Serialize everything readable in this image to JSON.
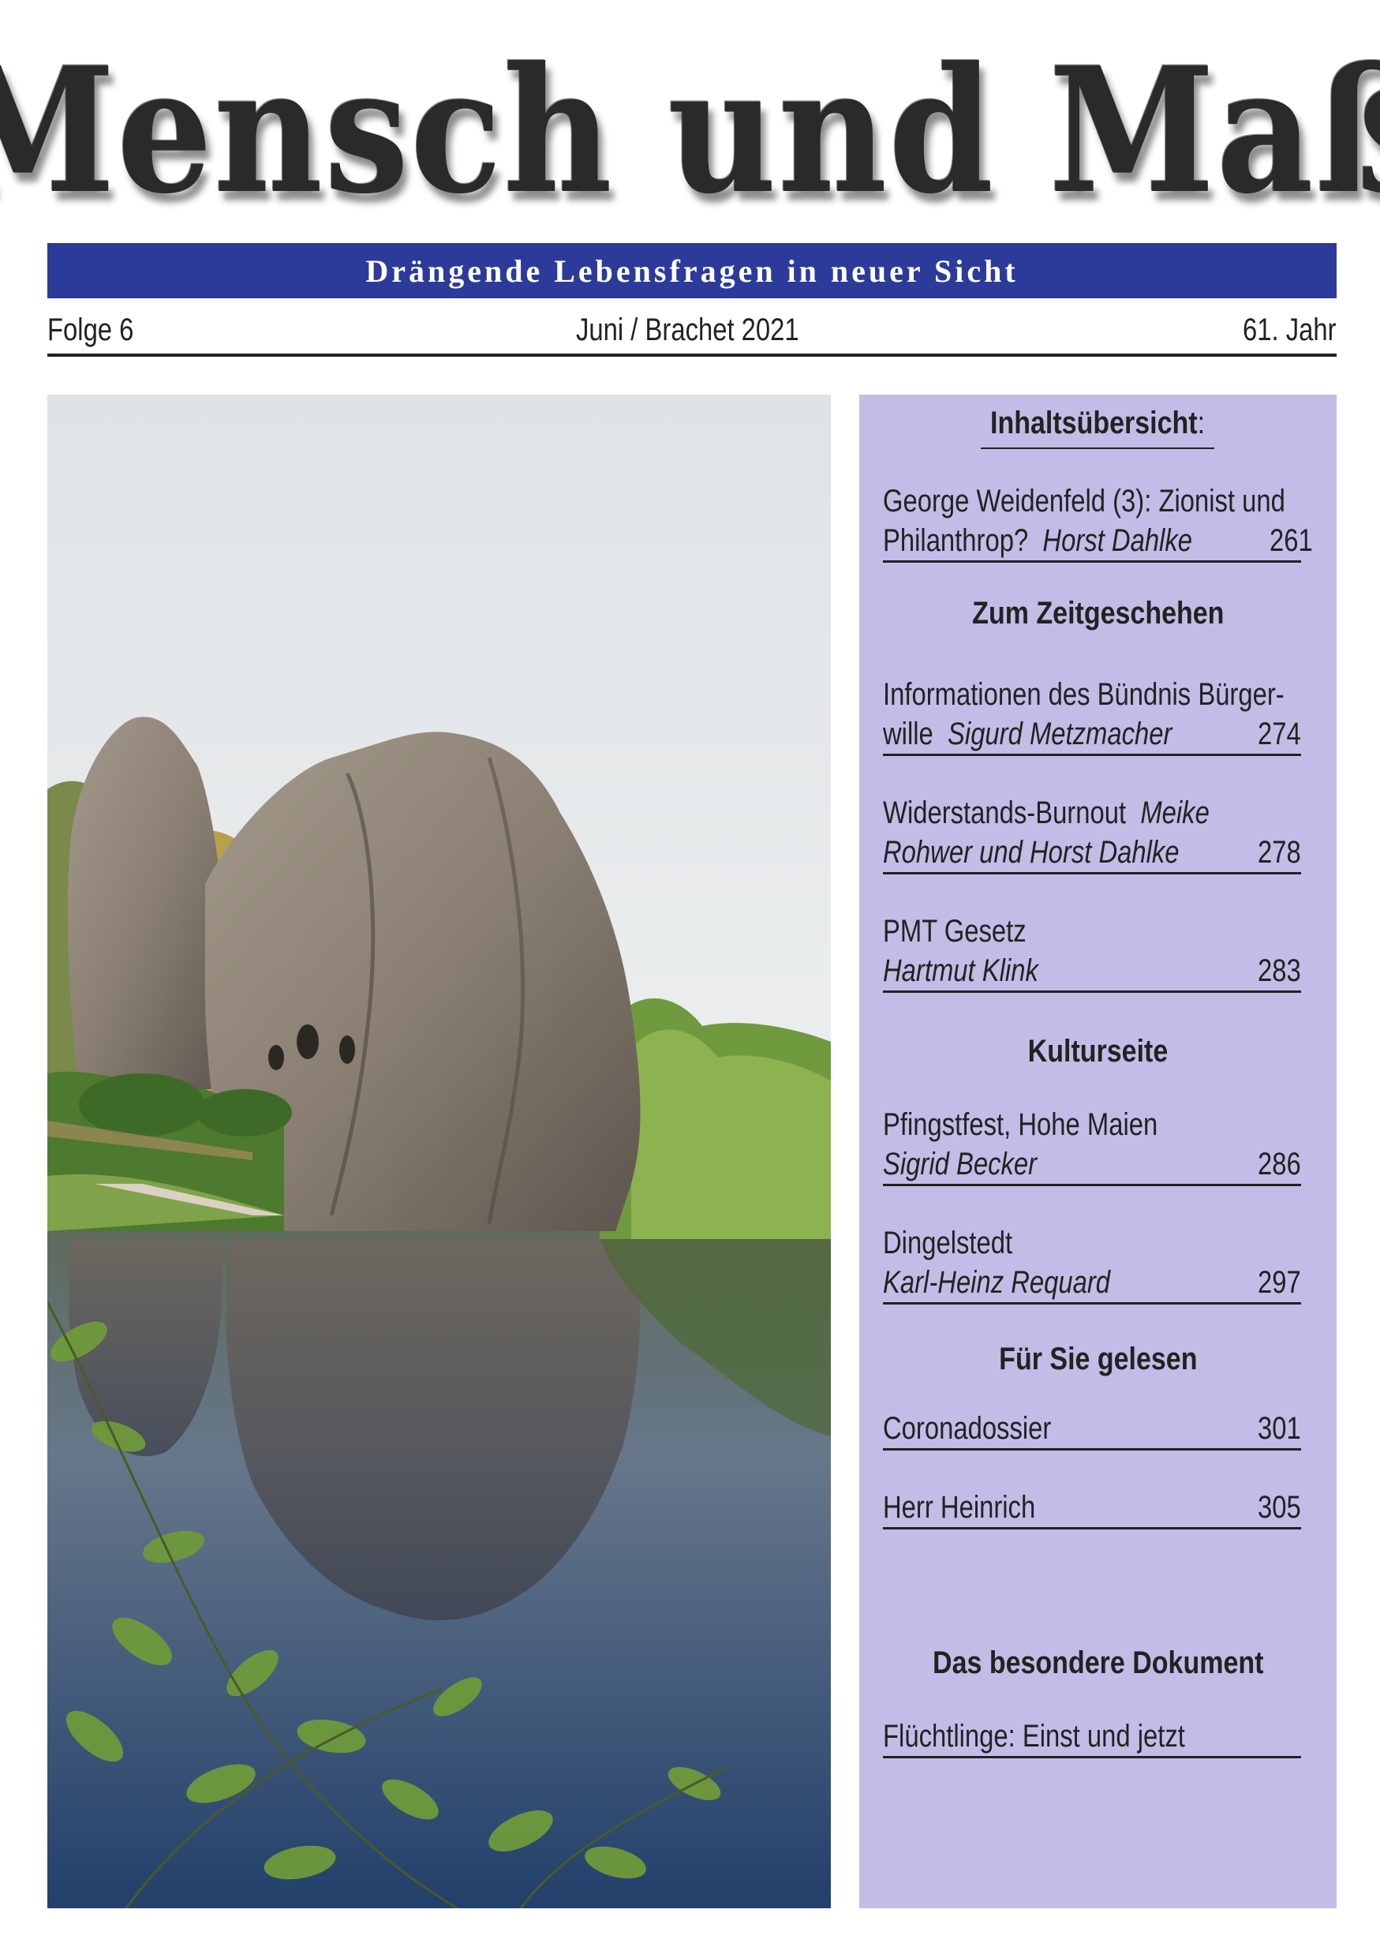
{
  "masthead": {
    "title": "Mensch und Maß",
    "tagline": "Drängende Lebensfragen in neuer Sicht"
  },
  "issue": {
    "number": "Folge 6",
    "date": "Juni / Brachet 2021",
    "year": "61. Jahr"
  },
  "colors": {
    "tagline_bar": "#2c3b9a",
    "toc_background": "#c2bde6"
  },
  "cover_image": {
    "subject": "sandstone rock formation reflected in a lake, green trees"
  },
  "toc": {
    "title": "Inhaltsübersicht",
    "title_suffix": ":",
    "entry1": {
      "line1": "George Weidenfeld (3): Zionist und",
      "line2_text": "Philanthrop?",
      "line2_author": "Horst Dahlke",
      "page": "261"
    },
    "section1": "Zum Zeitgeschehen",
    "entry2": {
      "line1": "Informationen des Bündnis Bürger-",
      "line2_text": "wille",
      "line2_author": "Sigurd Metzmacher",
      "page": "274"
    },
    "entry3": {
      "line1_text": "Widerstands-Burnout",
      "line1_author": "Meike",
      "line2_author": "Rohwer und Horst Dahlke",
      "page": "278"
    },
    "entry4": {
      "line1": "PMT Gesetz",
      "line2_author": "Hartmut Klink",
      "page": "283"
    },
    "section2": "Kulturseite",
    "entry5": {
      "line1": "Pfingstfest, Hohe Maien",
      "line2_author": "Sigrid Becker",
      "page": "286"
    },
    "entry6": {
      "line1": "Dingelstedt",
      "line2_author": "Karl-Heinz Requard",
      "page": "297"
    },
    "section3": "Für Sie gelesen",
    "entry7": {
      "title": "Coronadossier",
      "page": "301"
    },
    "entry8": {
      "title": "Herr Heinrich",
      "page": "305"
    },
    "section4": "Das besondere Dokument",
    "entry9": {
      "title": "Flüchtlinge: Einst und jetzt"
    }
  }
}
